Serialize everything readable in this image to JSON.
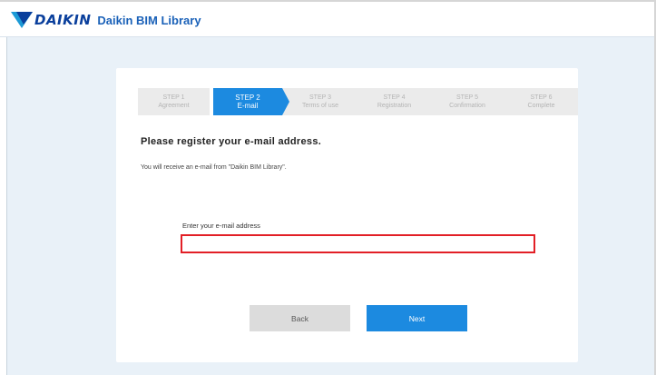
{
  "header": {
    "logo_text": "DAIKIN",
    "app_title": "Daikin BIM Library",
    "brand_colors": {
      "dark": "#0a3f9c",
      "light": "#1c9ad6"
    }
  },
  "steps": [
    {
      "label": "STEP 1",
      "sub": "Agreement",
      "active": false
    },
    {
      "label": "STEP 2",
      "sub": "E-mail",
      "active": true
    },
    {
      "label": "STEP 3",
      "sub": "Terms of use",
      "active": false
    },
    {
      "label": "STEP 4",
      "sub": "Registration",
      "active": false
    },
    {
      "label": "STEP 5",
      "sub": "Confirmation",
      "active": false
    },
    {
      "label": "STEP 6",
      "sub": "Complete",
      "active": false
    }
  ],
  "form": {
    "heading": "Please register your e-mail address.",
    "info": "You will receive an e-mail from \"Daikin BIM Library\".",
    "email_label": "Enter your e-mail address",
    "email_value": ""
  },
  "buttons": {
    "back": "Back",
    "next": "Next"
  },
  "colors": {
    "accent": "#1c8ae0",
    "error_border": "#e21f26",
    "background": "#e9f1f8"
  }
}
